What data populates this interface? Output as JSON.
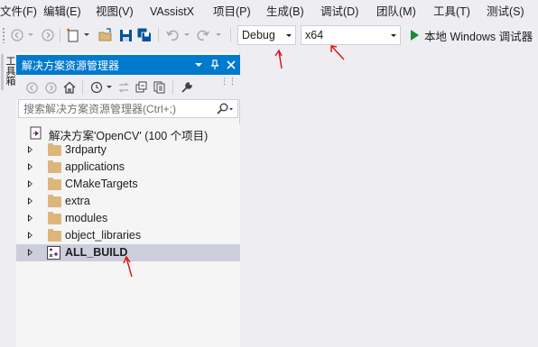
{
  "menu": [
    "文件(F)",
    "编辑(E)",
    "视图(V)",
    "VAssistX",
    "项目(P)",
    "生成(B)",
    "调试(D)",
    "团队(M)",
    "工具(T)",
    "测试(S)"
  ],
  "toolbar": {
    "config_value": "Debug",
    "platform_value": "x64",
    "run_label": "本地 Windows 调试器"
  },
  "toolstrip": {
    "tab_label": "工具箱"
  },
  "panel": {
    "title": "解决方案资源管理器",
    "search_placeholder": "搜索解决方案资源管理器(Ctrl+;)",
    "header_colors": {
      "accent": "#007acc",
      "selected_row": "#cccedb",
      "folder": "#dcb67a"
    }
  },
  "tree": {
    "solution_label": "解决方案'OpenCV' (100 个项目)",
    "folders": [
      "3rdparty",
      "applications",
      "CMakeTargets",
      "extra",
      "modules",
      "object_libraries"
    ],
    "project_label": "ALL_BUILD"
  },
  "annotation": {
    "arrow_color": "#e01010",
    "arrow_count": 3
  }
}
